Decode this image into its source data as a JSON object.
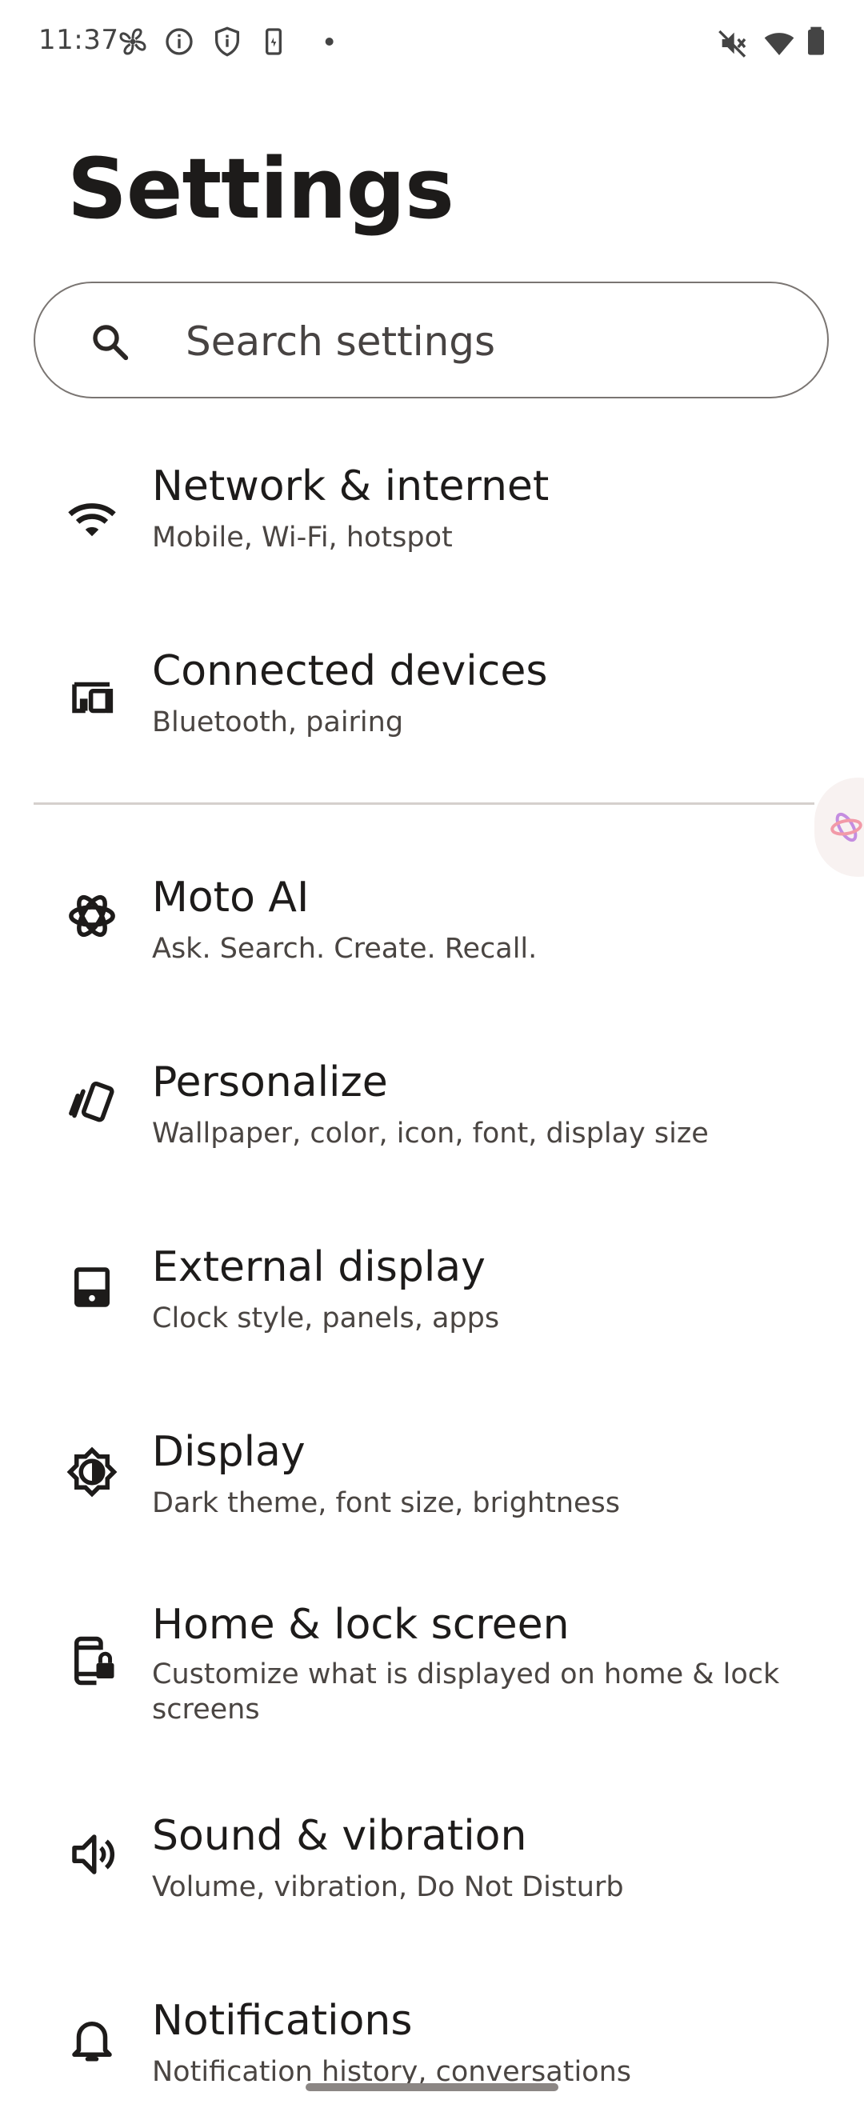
{
  "status_bar": {
    "time": "11:37",
    "left_icons": [
      "fan-icon",
      "info-icon",
      "shield-icon",
      "battery-saver-icon",
      "dot-icon"
    ],
    "right_icons": [
      "mute-icon",
      "wifi-icon",
      "battery-icon"
    ]
  },
  "header": {
    "title": "Settings"
  },
  "search": {
    "placeholder": "Search settings"
  },
  "settings": [
    {
      "icon": "wifi-icon",
      "title": "Network & internet",
      "subtitle": "Mobile, Wi-Fi, hotspot"
    },
    {
      "icon": "devices-icon",
      "title": "Connected devices",
      "subtitle": "Bluetooth, pairing"
    },
    {
      "icon": "moto-ai-icon",
      "title": "Moto AI",
      "subtitle": "Ask. Search. Create. Recall."
    },
    {
      "icon": "personalize-icon",
      "title": "Personalize",
      "subtitle": "Wallpaper, color, icon, font, display size"
    },
    {
      "icon": "external-display-icon",
      "title": "External display",
      "subtitle": "Clock style, panels, apps"
    },
    {
      "icon": "brightness-icon",
      "title": "Display",
      "subtitle": "Dark theme, font size, brightness"
    },
    {
      "icon": "lock-screen-icon",
      "title": "Home & lock screen",
      "subtitle": "Customize what is displayed on home & lock screens"
    },
    {
      "icon": "volume-icon",
      "title": "Sound & vibration",
      "subtitle": "Volume, vibration, Do Not Disturb"
    },
    {
      "icon": "bell-icon",
      "title": "Notifications",
      "subtitle": "Notification history, conversations"
    }
  ]
}
